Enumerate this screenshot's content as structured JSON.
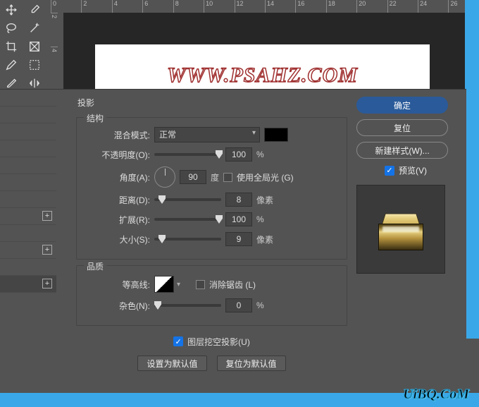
{
  "ruler_h": [
    "0",
    "2",
    "4",
    "6",
    "8",
    "10",
    "12",
    "14",
    "16",
    "18",
    "20",
    "22",
    "24",
    "26"
  ],
  "ruler_v": [
    "2",
    "4"
  ],
  "canvas": {
    "watermark": "WWW.PSAHZ.COM"
  },
  "dialog": {
    "close": "×",
    "section_title": "投影",
    "structure_title": "结构",
    "blend_mode_label": "混合模式:",
    "blend_mode_value": "正常",
    "color_swatch": "#000000",
    "opacity_label": "不透明度(O):",
    "opacity_value": "100",
    "opacity_unit": "%",
    "angle_label": "角度(A):",
    "angle_value": "90",
    "angle_unit": "度",
    "global_light_label": "使用全局光 (G)",
    "global_light_checked": false,
    "distance_label": "距离(D):",
    "distance_value": "8",
    "distance_unit": "像素",
    "spread_label": "扩展(R):",
    "spread_value": "100",
    "spread_unit": "%",
    "size_label": "大小(S):",
    "size_value": "9",
    "size_unit": "像素",
    "quality_title": "品质",
    "contour_label": "等高线:",
    "antialias_label": "消除锯齿 (L)",
    "antialias_checked": false,
    "noise_label": "杂色(N):",
    "noise_value": "0",
    "noise_unit": "%",
    "knockout_label": "图层挖空投影(U)",
    "knockout_checked": true,
    "make_default": "设置为默认值",
    "reset_default": "复位为默认值"
  },
  "right": {
    "ok": "确定",
    "reset": "复位",
    "new_style": "新建样式(W)...",
    "preview_label": "预览(V)",
    "preview_checked": true
  },
  "tools": [
    "move",
    "dropper",
    "lasso",
    "wand",
    "crop",
    "frame",
    "pencil",
    "dashed-square",
    "brush",
    "horiz-flip"
  ],
  "footer_watermark": "UiBQ.CoM"
}
